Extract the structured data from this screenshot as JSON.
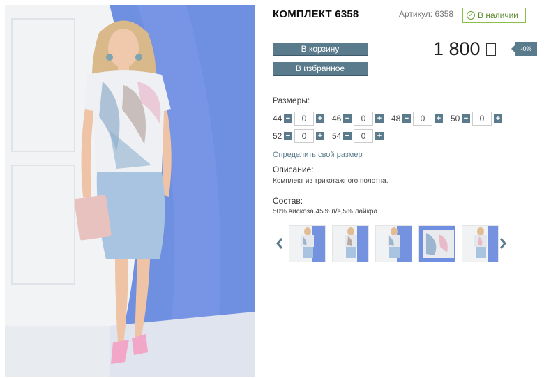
{
  "product": {
    "title": "КОМПЛЕКТ 6358",
    "sku_label": "Артикул: 6358",
    "stock_label": "В наличии",
    "main_image_alt": "Model in printed top and light blue skirt"
  },
  "actions": {
    "cart_label": "В корзину",
    "favorites_label": "В избранное"
  },
  "price": {
    "value": "1 800",
    "discount": "-0%"
  },
  "sizes": {
    "label": "Размеры:",
    "items": [
      {
        "size": "44",
        "qty": "0"
      },
      {
        "size": "46",
        "qty": "0"
      },
      {
        "size": "48",
        "qty": "0"
      },
      {
        "size": "50",
        "qty": "0"
      },
      {
        "size": "52",
        "qty": "0"
      },
      {
        "size": "54",
        "qty": "0"
      }
    ],
    "minus_symbol": "−",
    "plus_symbol": "+",
    "size_link": "Определить свой размер"
  },
  "description": {
    "label": "Описание:",
    "text": "Комплект из трикотажного полотна."
  },
  "composition": {
    "label": "Состав:",
    "text": "50% вискоза,45% п/э,5% лайкра"
  },
  "colors": {
    "accent": "#5a7b8c",
    "stock_green": "#6aa431",
    "skirt_blue": "#a9c4e0",
    "background_blue": "#6f8fe0"
  },
  "icons": {
    "stock": "check-circle-icon",
    "currency": "currency-icon",
    "prev": "chevron-left-icon",
    "next": "chevron-right-icon"
  }
}
